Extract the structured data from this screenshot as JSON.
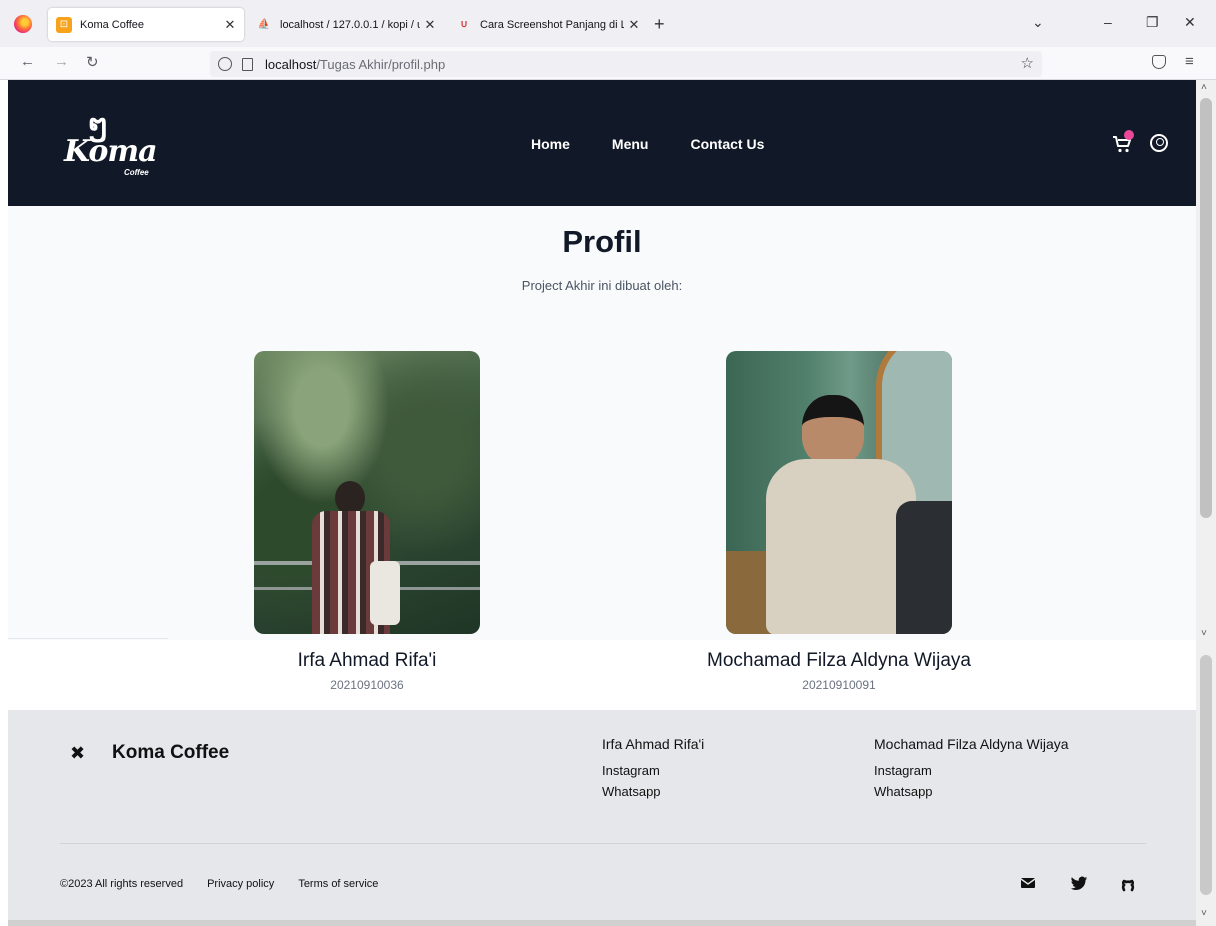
{
  "browser": {
    "tabs": [
      {
        "title": "Koma Coffee",
        "active": true
      },
      {
        "title": "localhost / 127.0.0.1 / kopi / use",
        "active": false
      },
      {
        "title": "Cara Screenshot Panjang di Lap",
        "active": false
      }
    ],
    "url_host": "localhost",
    "url_path": "/Tugas Akhir/profil.php"
  },
  "header": {
    "logo_word": "Koma",
    "logo_sub": "Coffee",
    "nav": [
      "Home",
      "Menu",
      "Contact Us"
    ]
  },
  "main": {
    "title": "Profil",
    "subtitle": "Project Akhir ini dibuat oleh:",
    "members": [
      {
        "name": "Irfa Ahmad Rifa'i",
        "nim": "20210910036"
      },
      {
        "name": "Mochamad Filza Aldyna Wijaya",
        "nim": "20210910091"
      }
    ]
  },
  "footer": {
    "brand": "Koma Coffee",
    "columns": [
      {
        "heading": "Irfa Ahmad Rifa'i",
        "links": [
          "Instagram",
          "Whatsapp"
        ]
      },
      {
        "heading": "Mochamad Filza Aldyna Wijaya",
        "links": [
          "Instagram",
          "Whatsapp"
        ]
      }
    ],
    "copyright": "©2023 All rights reserved",
    "legal_links": [
      "Privacy policy",
      "Terms of service"
    ],
    "social_icons": [
      "mail-icon",
      "twitter-icon",
      "github-icon"
    ]
  },
  "colors": {
    "header_bg": "#111827",
    "cart_badge": "#ec4899",
    "footer_bg": "#e5e7eb"
  }
}
